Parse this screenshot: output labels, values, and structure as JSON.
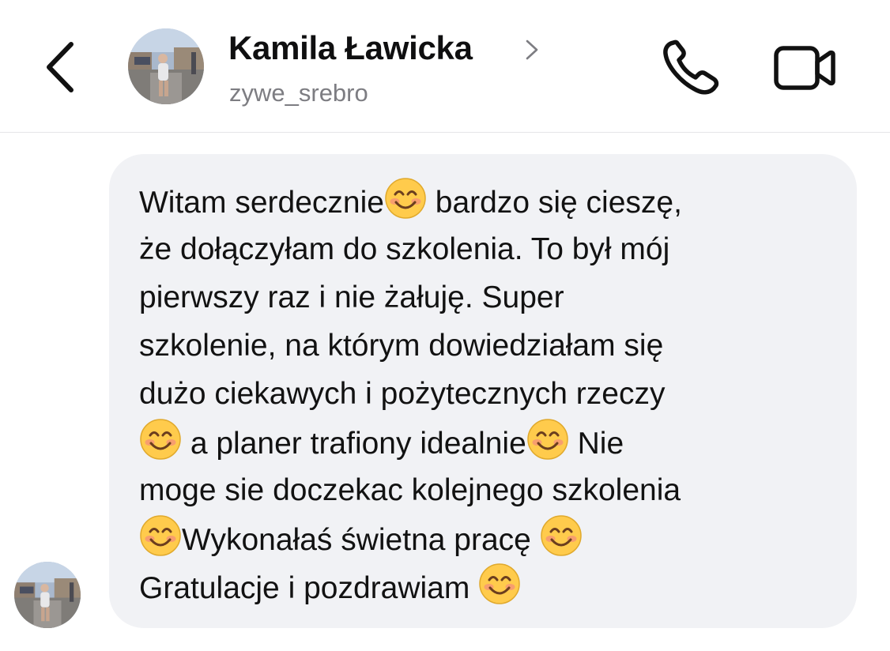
{
  "header": {
    "name": "Kamila Ławicka",
    "username": "zywe_srebro"
  },
  "icons": {
    "back": "chevron-left-icon",
    "profile_link": "chevron-right-icon",
    "call": "phone-icon",
    "video": "video-camera-icon",
    "emoji": "smiling-face-emoji"
  },
  "colors": {
    "bubble": "#f1f2f5",
    "username": "#7d7d82",
    "emoji_face": "#ffcb4c",
    "emoji_blush": "#f48f7a"
  },
  "message": {
    "segments": [
      "Witam serdecznie",
      " bardzo się cieszę,",
      "że dołączyłam do szkolenia. To był mój",
      "pierwszy raz i nie żałuję. Super",
      "szkolenie, na którym dowiedziałam się",
      "dużo ciekawych i pożytecznych rzeczy",
      " a planer trafiony idealnie",
      " Nie",
      "moge sie doczekac kolejnego szkolenia",
      "Wykonałaś świetna pracę ",
      "Gratulacje i pozdrawiam "
    ]
  }
}
